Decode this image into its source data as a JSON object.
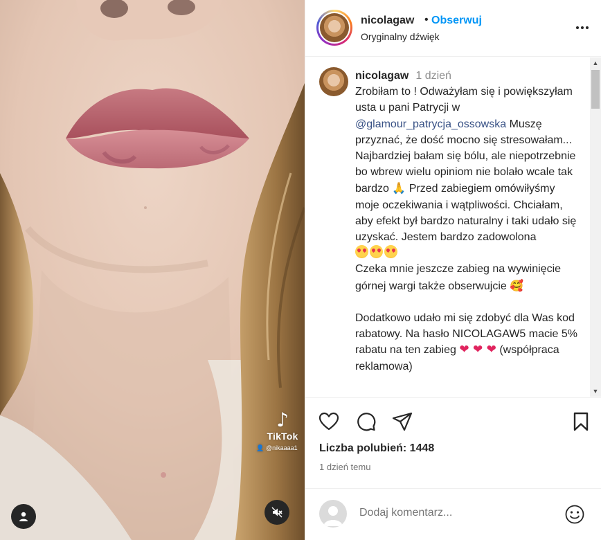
{
  "media": {
    "watermark": {
      "brand": "TikTok",
      "handle": "@nikaaaa1"
    },
    "icons": {
      "user": "user-tag-icon",
      "mute": "speaker-muted-icon",
      "tiktok": "tiktok-note-icon"
    }
  },
  "header": {
    "username": "nicolagaw",
    "separator": "•",
    "follow_label": "Obserwuj",
    "audio": "Oryginalny dźwięk",
    "more_icon": "more-options-icon"
  },
  "caption": {
    "username": "nicolagaw",
    "time": "1 dzień",
    "para1_a": "Zrobiłam to ! Odważyłam się i powiększyłam usta u pani Patrycji w ",
    "mention": "@glamour_patrycja_ossowska",
    "para1_b": " Muszę przyznać, że dość mocno się stresowałam... Najbardziej bałam się bólu, ale niepotrzebnie bo wbrew wielu opiniom nie bolało wcale tak bardzo ",
    "emoji_praying": "🙏",
    "para1_c": " Przed zabiegiem omówiłyśmy moje oczekiwania i wątpliwości. Chciałam, aby efekt był bardzo naturalny i taki udało się uzyskać. Jestem bardzo zadowolona",
    "para2": "Czeka mnie jeszcze zabieg na wywinięcie górnej wargi także obserwujcie ",
    "emoji_hearts_face": "🥰",
    "para3": "Dodatkowo udało mi się zdobyć dla Was kod rabatowy. Na hasło NICOLAGAW5 macie 5% rabatu na ten zabieg ",
    "hearts": "❤ ❤ ❤",
    "para3_tail": " (współpraca reklamowa)"
  },
  "actions": {
    "icons": [
      "heart-icon",
      "comment-icon",
      "share-icon",
      "bookmark-icon"
    ],
    "likes_label": "Liczba polubień:",
    "likes_count": "1448",
    "time_ago": "1 dzień temu"
  },
  "add_comment": {
    "placeholder": "Dodaj komentarz...",
    "emoji_icon": "smiley-icon"
  },
  "colors": {
    "link": "#0095f6",
    "mention": "#385185",
    "text": "#262626",
    "muted": "#8e8e8e"
  }
}
